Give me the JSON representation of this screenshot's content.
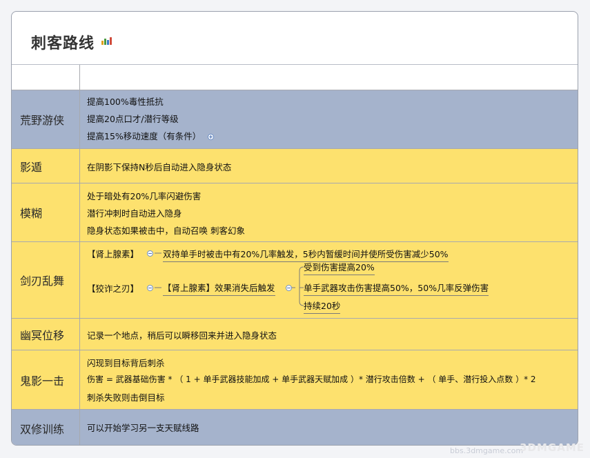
{
  "title": "刺客路线",
  "rows": [
    {
      "name": "荒野游侠",
      "lines": [
        "提高100%毒性抵抗",
        "提高20点口才/潜行等级",
        "提高15%移动速度（有条件）"
      ]
    },
    {
      "name": "影遁",
      "lines": [
        "在阴影下保持N秒后自动进入隐身状态"
      ]
    },
    {
      "name": "模糊",
      "lines": [
        "处于暗处有20%几率闪避伤害",
        "潜行冲刺时自动进入隐身",
        "隐身状态如果被击中，自动召唤 刺客幻象"
      ]
    },
    {
      "name": "剑刃乱舞",
      "mindmap": {
        "node1": "【肾上腺素】",
        "node1_child": "双持单手时被击中有20%几率触发，5秒内暂缓时间并使所受伤害减少50%",
        "node2": "【狡诈之刃】",
        "node2_child": "【肾上腺素】效果消失后触发",
        "node2_leaves": [
          "受到伤害提高20%",
          "单手武器攻击伤害提高50%，50%几率反弹伤害",
          "持续20秒"
        ]
      }
    },
    {
      "name": "幽冥位移",
      "lines": [
        "记录一个地点，稍后可以瞬移回来并进入隐身状态"
      ]
    },
    {
      "name": "鬼影一击",
      "lines": [
        "闪现到目标背后刺杀",
        "伤害 = 武器基础伤害 * （ 1 + 单手武器技能加成 + 单手武器天赋加成 ）* 潜行攻击倍数 + （ 单手、潜行投入点数 ）* 2",
        "刺杀失败则击倒目标"
      ]
    },
    {
      "name": "双修训练",
      "lines": [
        "可以开始学习另一支天赋线路"
      ]
    }
  ],
  "watermark": "3DMGAME",
  "watermark_url": "bbs.3dmgame.com",
  "colors": {
    "blue_row": "#a5b3cc",
    "yellow_row": "#fde16e"
  }
}
